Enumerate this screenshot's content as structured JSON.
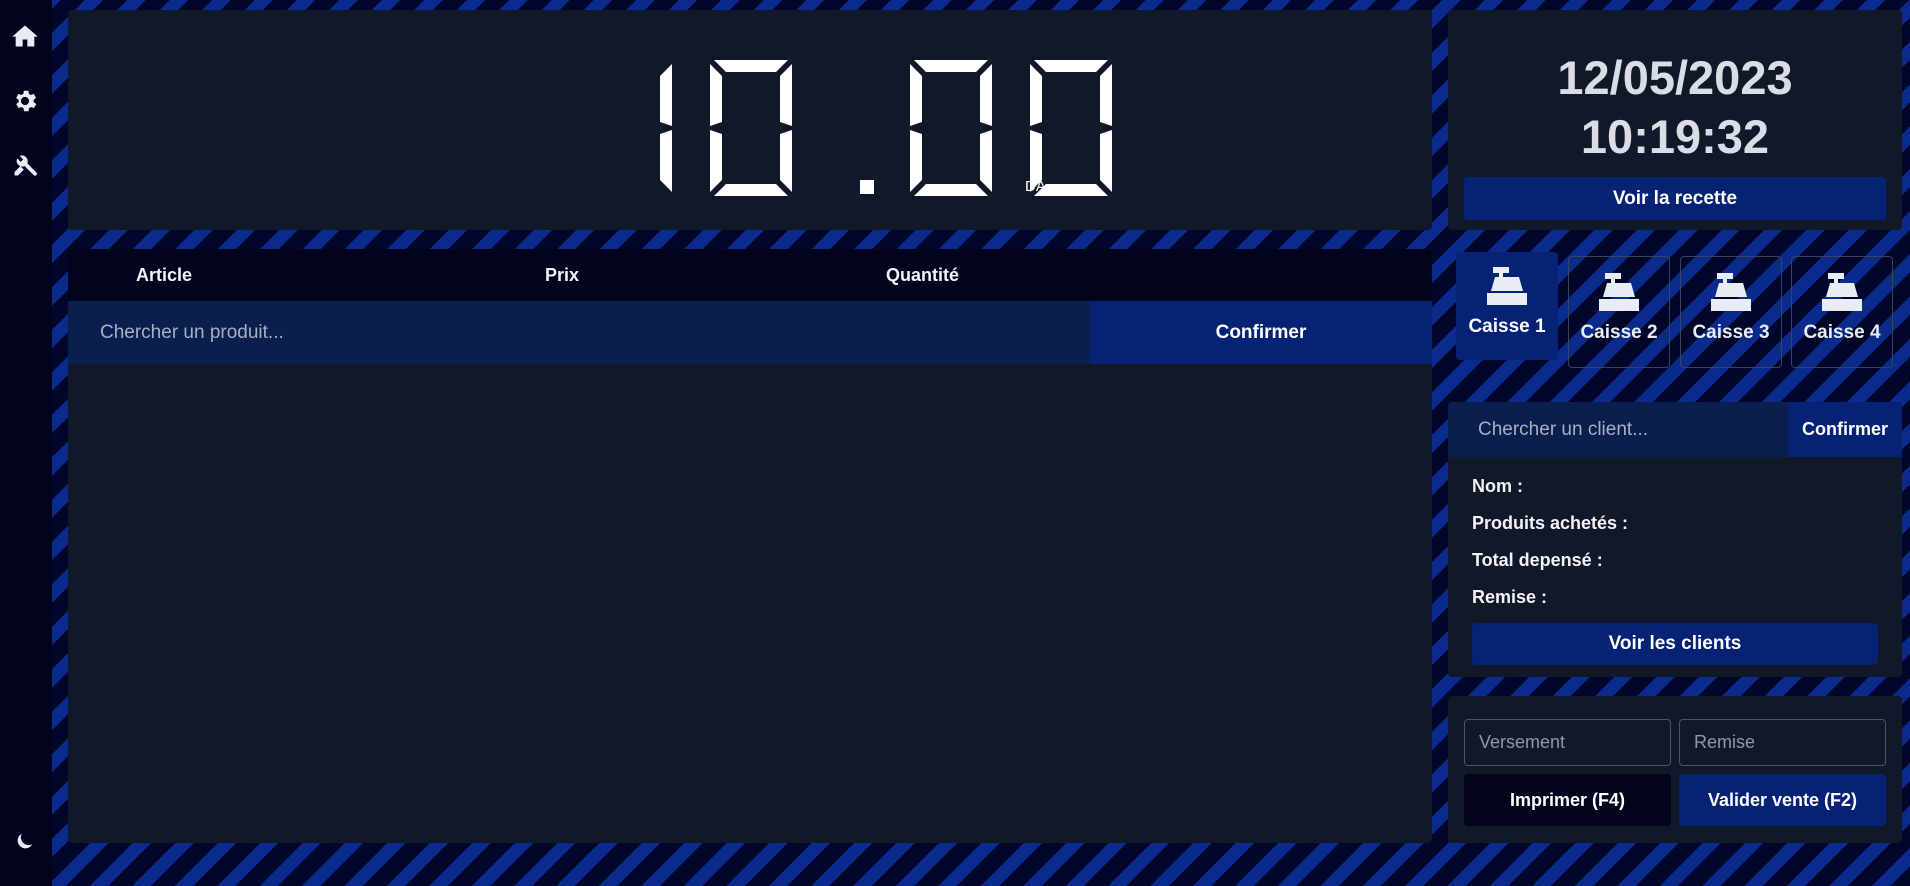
{
  "sidebar": {
    "icons": [
      "home-icon",
      "gear-icon",
      "tools-icon",
      "moon-icon"
    ]
  },
  "display": {
    "amount": "10.00",
    "currency": "DA"
  },
  "cart": {
    "columns": [
      "Article",
      "Prix",
      "Quantité"
    ],
    "search_placeholder": "Chercher un produit...",
    "confirm_label": "Confirmer"
  },
  "clock": {
    "date": "12/05/2023",
    "time": "10:19:32",
    "revenue_button": "Voir la recette"
  },
  "registers": [
    {
      "label": "Caisse 1",
      "active": true
    },
    {
      "label": "Caisse 2",
      "active": false
    },
    {
      "label": "Caisse 3",
      "active": false
    },
    {
      "label": "Caisse 4",
      "active": false
    }
  ],
  "client": {
    "search_placeholder": "Chercher un client...",
    "confirm_label": "Confirmer",
    "fields": [
      "Nom :",
      "Produits achetés :",
      "Total depensé :",
      "Remise :"
    ],
    "clients_button": "Voir les clients"
  },
  "payment": {
    "payment_placeholder": "Versement",
    "discount_placeholder": "Remise",
    "print_button": "Imprimer (F4)",
    "validate_button": "Valider vente (F2)"
  },
  "colors": {
    "background_dark": "#01041c",
    "panel": "#111827",
    "accent": "#062275",
    "stripe": "#0a2a8c"
  }
}
